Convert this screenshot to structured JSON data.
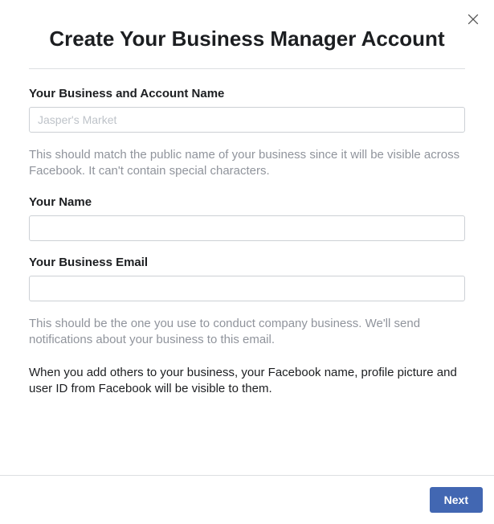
{
  "dialog": {
    "title": "Create Your Business Manager Account"
  },
  "form": {
    "business_name": {
      "label": "Your Business and Account Name",
      "placeholder": "Jasper's Market",
      "value": "",
      "helper": "This should match the public name of your business since it will be visible across Facebook. It can't contain special characters."
    },
    "your_name": {
      "label": "Your Name",
      "value": ""
    },
    "business_email": {
      "label": "Your Business Email",
      "value": "",
      "helper": "This should be the one you use to conduct company business. We'll send notifications about your business to this email."
    },
    "disclosure": "When you add others to your business, your Facebook name, profile picture and user ID from Facebook will be visible to them."
  },
  "footer": {
    "next_label": "Next"
  }
}
